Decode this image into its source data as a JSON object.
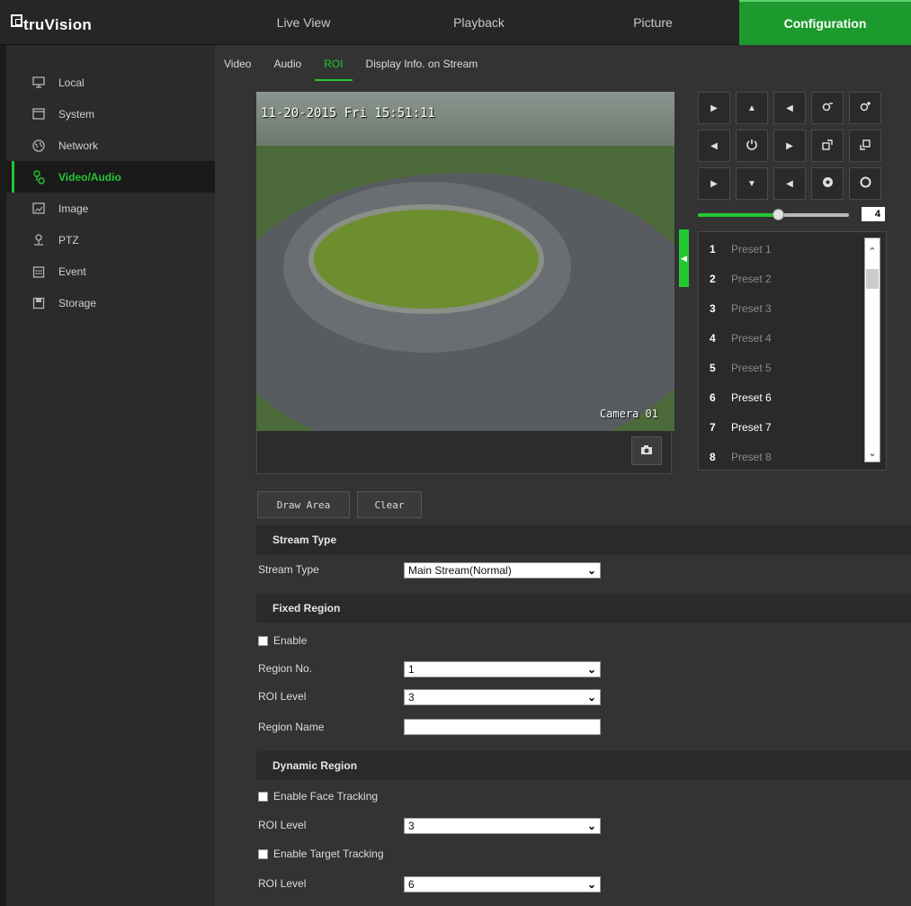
{
  "brand": "truVision",
  "topnav": [
    {
      "label": "Live View",
      "active": false
    },
    {
      "label": "Playback",
      "active": false
    },
    {
      "label": "Picture",
      "active": false
    },
    {
      "label": "Configuration",
      "active": true
    }
  ],
  "sidebar": {
    "items": [
      {
        "label": "Local",
        "icon": "monitor-icon",
        "active": false
      },
      {
        "label": "System",
        "icon": "system-icon",
        "active": false
      },
      {
        "label": "Network",
        "icon": "globe-icon",
        "active": false
      },
      {
        "label": "Video/Audio",
        "icon": "video-audio-icon",
        "active": true
      },
      {
        "label": "Image",
        "icon": "image-icon",
        "active": false
      },
      {
        "label": "PTZ",
        "icon": "ptz-icon",
        "active": false
      },
      {
        "label": "Event",
        "icon": "calendar-icon",
        "active": false
      },
      {
        "label": "Storage",
        "icon": "storage-icon",
        "active": false
      }
    ]
  },
  "subtabs": [
    {
      "label": "Video",
      "active": false
    },
    {
      "label": "Audio",
      "active": false
    },
    {
      "label": "ROI",
      "active": true
    },
    {
      "label": "Display Info. on Stream",
      "active": false
    }
  ],
  "video": {
    "timestamp": "11-20-2015 Fri 15:51:11",
    "camera_name": "Camera 01"
  },
  "ptz": {
    "zoom_value": "4",
    "zoom_fraction": 0.53,
    "presets": [
      {
        "num": "1",
        "name": "Preset 1",
        "set": false
      },
      {
        "num": "2",
        "name": "Preset 2",
        "set": false
      },
      {
        "num": "3",
        "name": "Preset 3",
        "set": false
      },
      {
        "num": "4",
        "name": "Preset 4",
        "set": false
      },
      {
        "num": "5",
        "name": "Preset 5",
        "set": false
      },
      {
        "num": "6",
        "name": "Preset 6",
        "set": true
      },
      {
        "num": "7",
        "name": "Preset 7",
        "set": true
      },
      {
        "num": "8",
        "name": "Preset 8",
        "set": false
      }
    ]
  },
  "buttons": {
    "draw_area": "Draw Area",
    "clear": "Clear"
  },
  "stream_type": {
    "heading": "Stream Type",
    "label": "Stream Type",
    "value": "Main Stream(Normal)"
  },
  "fixed_region": {
    "heading": "Fixed Region",
    "enable_label": "Enable",
    "region_no_label": "Region No.",
    "region_no_value": "1",
    "roi_level_label": "ROI Level",
    "roi_level_value": "3",
    "region_name_label": "Region Name",
    "region_name_value": ""
  },
  "dynamic_region": {
    "heading": "Dynamic Region",
    "face_tracking_label": "Enable Face Tracking",
    "face_roi_label": "ROI Level",
    "face_roi_value": "3",
    "target_tracking_label": "Enable Target Tracking",
    "target_roi_label": "ROI Level",
    "target_roi_value": "6"
  },
  "colors": {
    "accent": "#22c832",
    "config_tab": "#1d9a2d"
  }
}
